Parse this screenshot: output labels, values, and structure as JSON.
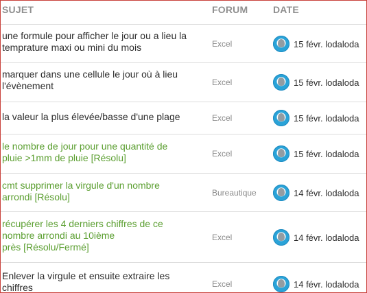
{
  "header": {
    "subject": "SUJET",
    "forum": "FORUM",
    "date": "DATE"
  },
  "rows": [
    {
      "subject_lines": [
        "une formule pour afficher le jour ou a lieu la",
        "temprature maxi ou mini du mois"
      ],
      "solved": false,
      "forum": "Excel",
      "date": "15 févr.",
      "author": "lodaloda"
    },
    {
      "subject_lines": [
        "marquer dans une cellule le jour où à lieu",
        "l'évènement"
      ],
      "solved": false,
      "forum": "Excel",
      "date": "15 févr.",
      "author": "lodaloda"
    },
    {
      "subject_lines": [
        "la valeur la plus élevée/basse d'une plage"
      ],
      "solved": false,
      "forum": "Excel",
      "date": "15 févr.",
      "author": "lodaloda"
    },
    {
      "subject_lines": [
        "le nombre de jour pour une quantité de",
        "pluie >1mm de pluie [Résolu]"
      ],
      "solved": true,
      "forum": "Excel",
      "date": "15 févr.",
      "author": "lodaloda"
    },
    {
      "subject_lines": [
        "cmt supprimer la virgule d'un nombre",
        "arrondi [Résolu]"
      ],
      "solved": true,
      "forum": "Bureautique",
      "date": "14 févr.",
      "author": "lodaloda"
    },
    {
      "subject_lines": [
        "récupérer les 4 derniers chiffres de ce",
        "nombre arrondi au 10ième",
        "près [Résolu/Fermé]"
      ],
      "solved": true,
      "forum": "Excel",
      "date": "14 févr.",
      "author": "lodaloda"
    },
    {
      "subject_lines": [
        "Enlever la virgule et ensuite extraire les",
        "chiffres"
      ],
      "solved": false,
      "forum": "Excel",
      "date": "14 févr.",
      "author": "lodaloda"
    }
  ]
}
